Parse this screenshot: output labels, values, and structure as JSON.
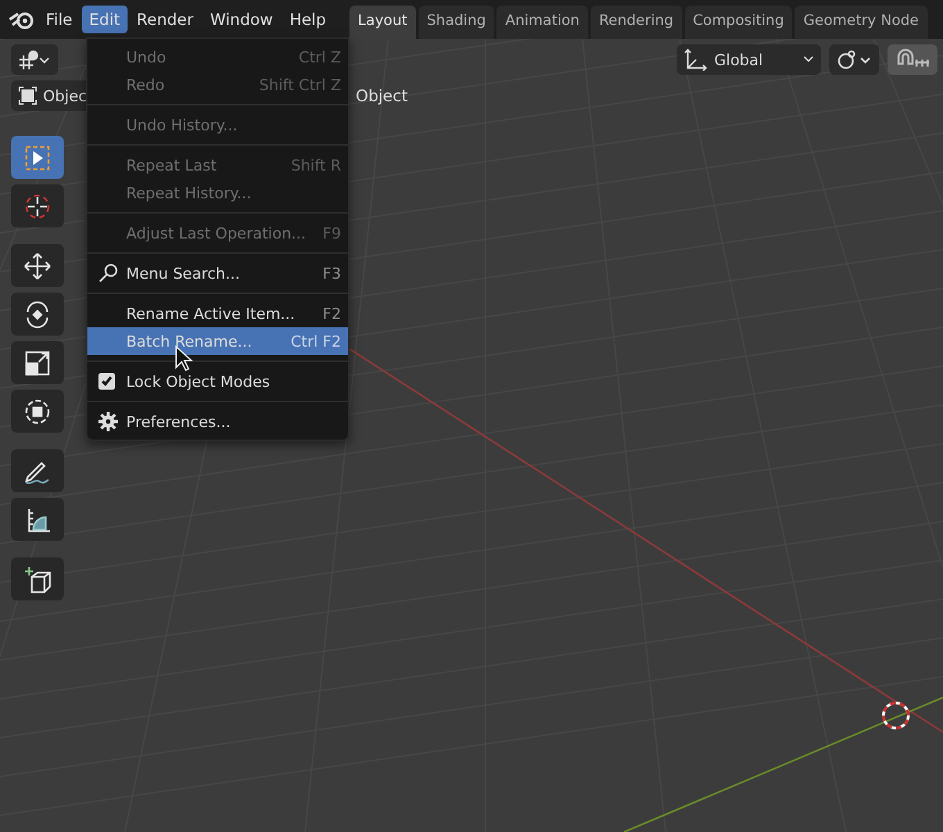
{
  "menubar": {
    "items": [
      {
        "label": "File",
        "selected": false
      },
      {
        "label": "Edit",
        "selected": true
      },
      {
        "label": "Render",
        "selected": false
      },
      {
        "label": "Window",
        "selected": false
      },
      {
        "label": "Help",
        "selected": false
      }
    ]
  },
  "workspaces": [
    {
      "label": "Layout",
      "selected": true
    },
    {
      "label": "Shading",
      "selected": false
    },
    {
      "label": "Animation",
      "selected": false
    },
    {
      "label": "Rendering",
      "selected": false
    },
    {
      "label": "Compositing",
      "selected": false
    },
    {
      "label": "Geometry Node",
      "selected": false
    }
  ],
  "header": {
    "mode": "Objec",
    "object_menu": "Object",
    "orientation": "Global"
  },
  "toolbar": [
    {
      "kind": "select",
      "selected": true
    },
    {
      "kind": "cursor",
      "selected": false
    },
    {
      "kind": "move",
      "selected": false
    },
    {
      "kind": "rotate",
      "selected": false
    },
    {
      "kind": "scale",
      "selected": false
    },
    {
      "kind": "transform",
      "selected": false
    },
    {
      "kind": "annotate",
      "selected": false
    },
    {
      "kind": "measure",
      "selected": false
    },
    {
      "kind": "add-cube",
      "selected": false
    }
  ],
  "edit_menu": [
    [
      {
        "kind": "plain",
        "label": "Undo",
        "shortcut": "Ctrl Z",
        "disabled": true,
        "selected": false
      },
      {
        "kind": "plain",
        "label": "Redo",
        "shortcut": "Shift Ctrl Z",
        "disabled": true,
        "selected": false
      }
    ],
    [
      {
        "kind": "plain",
        "label": "Undo History...",
        "disabled": true,
        "selected": false
      }
    ],
    [
      {
        "kind": "plain",
        "label": "Repeat Last",
        "shortcut": "Shift R",
        "disabled": true,
        "selected": false
      },
      {
        "kind": "plain",
        "label": "Repeat History...",
        "disabled": true,
        "selected": false
      }
    ],
    [
      {
        "kind": "plain",
        "label": "Adjust Last Operation...",
        "shortcut": "F9",
        "disabled": true,
        "selected": false
      }
    ],
    [
      {
        "kind": "search",
        "label": "Menu Search...",
        "shortcut": "F3",
        "disabled": false,
        "selected": false
      }
    ],
    [
      {
        "kind": "plain",
        "label": "Rename Active Item...",
        "shortcut": "F2",
        "disabled": false,
        "selected": false
      },
      {
        "kind": "plain",
        "label": "Batch Rename...",
        "shortcut": "Ctrl F2",
        "disabled": false,
        "selected": true
      }
    ],
    [
      {
        "kind": "checkbox",
        "label": "Lock Object Modes",
        "checked": true,
        "disabled": false,
        "selected": false
      }
    ],
    [
      {
        "kind": "gear",
        "label": "Preferences...",
        "disabled": false,
        "selected": false
      }
    ]
  ]
}
